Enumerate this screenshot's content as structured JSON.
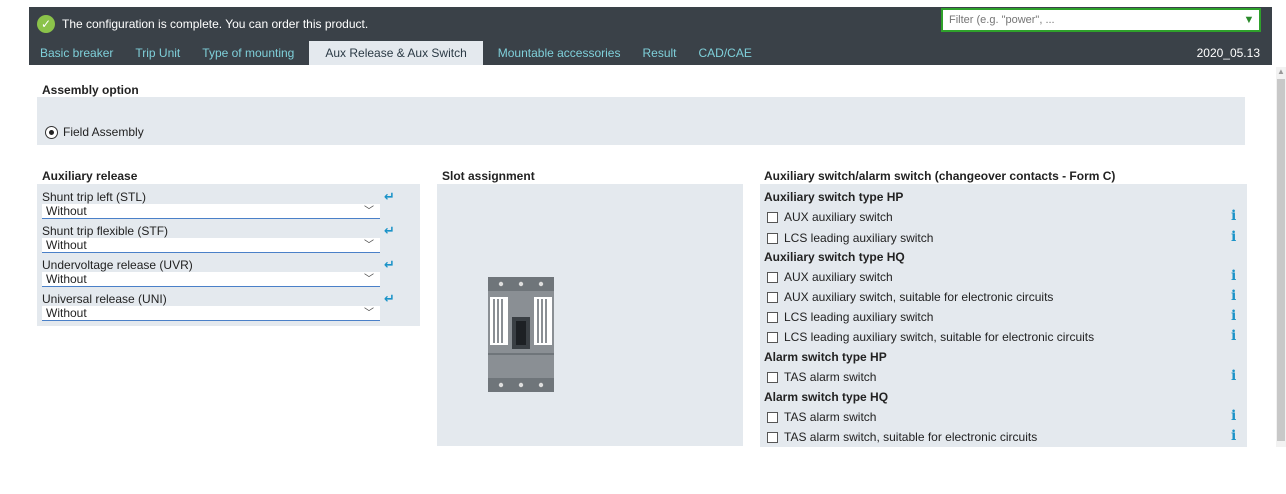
{
  "header": {
    "status_text": "The configuration is complete. You can order this product.",
    "filter_placeholder": "Filter (e.g. \"power\", ...",
    "version": "2020_05.13",
    "tabs": [
      {
        "label": "Basic breaker"
      },
      {
        "label": "Trip Unit"
      },
      {
        "label": "Type of mounting"
      },
      {
        "label": "Aux Release & Aux Switch",
        "active": true
      },
      {
        "label": "Mountable accessories"
      },
      {
        "label": "Result"
      },
      {
        "label": "CAD/CAE"
      }
    ]
  },
  "assembly": {
    "title": "Assembly option",
    "option_label": "Field Assembly",
    "selected": true
  },
  "aux_release": {
    "title": "Auxiliary release",
    "items": [
      {
        "label": "Shunt trip left (STL)",
        "value": "Without"
      },
      {
        "label": "Shunt trip flexible (STF)",
        "value": "Without"
      },
      {
        "label": "Undervoltage release (UVR)",
        "value": "Without"
      },
      {
        "label": "Universal release (UNI)",
        "value": "Without"
      }
    ]
  },
  "slot": {
    "title": "Slot assignment"
  },
  "aux_switch": {
    "title": "Auxiliary switch/alarm switch (changeover contacts - Form C)",
    "groups": [
      {
        "title": "Auxiliary switch type HP",
        "items": [
          "AUX auxiliary switch",
          "LCS leading auxiliary switch"
        ]
      },
      {
        "title": "Auxiliary switch type HQ",
        "items": [
          "AUX auxiliary switch",
          "AUX auxiliary switch, suitable for electronic circuits",
          "LCS leading auxiliary switch",
          "LCS leading auxiliary switch, suitable for electronic circuits"
        ]
      },
      {
        "title": "Alarm switch type HP",
        "items": [
          "TAS alarm switch"
        ]
      },
      {
        "title": "Alarm switch type HQ",
        "items": [
          "TAS alarm switch",
          "TAS alarm switch, suitable for electronic circuits"
        ]
      }
    ],
    "info_glyph": "i"
  },
  "colors": {
    "header_bg": "#3a4148",
    "tab_text": "#7fd0da",
    "panel_bg": "#e4e9ee",
    "accent_blue": "#1a93c8",
    "filter_border": "#2fa12b",
    "ok_green": "#8bc34a"
  }
}
